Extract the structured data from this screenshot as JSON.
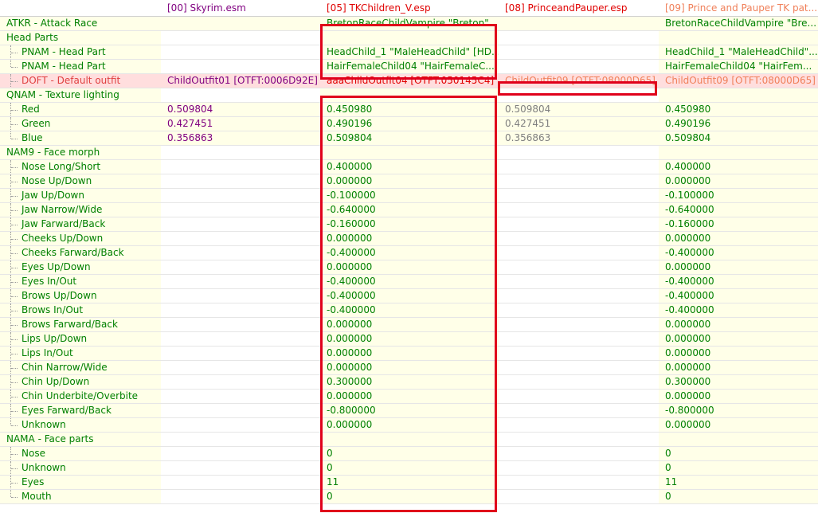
{
  "header": {
    "col0": "",
    "col1": "[00] Skyrim.esm",
    "col2": "[05] TKChildren_V.esp",
    "col3": "[08] PrinceandPauper.esp",
    "col4": "[09] Prince and Pauper TK pat..."
  },
  "colors": {
    "label": "#008000",
    "skyrim": "#800080",
    "override_conflict": "#e00000",
    "losing": "#7f7f7f",
    "highlight_border": "#e0001b"
  },
  "rows": [
    {
      "label": "ATKR - Attack Race",
      "c1": "",
      "c2": "BretonRaceChildVampire \"Breton\"...",
      "c3": "",
      "c4": "BretonRaceChildVampire \"Bre..."
    },
    {
      "label": "Head Parts",
      "c1": "",
      "c2": "",
      "c3": "",
      "c4": ""
    },
    {
      "label": "PNAM - Head Part",
      "c1": "",
      "c2": "HeadChild_1 \"MaleHeadChild\" [HD...",
      "c3": "",
      "c4": "HeadChild_1 \"MaleHeadChild\"..."
    },
    {
      "label": "PNAM - Head Part",
      "c1": "",
      "c2": "HairFemaleChild04 \"HairFemaleC...",
      "c3": "",
      "c4": "HairFemaleChild04 \"HairFem..."
    },
    {
      "label": "DOFT - Default outfit",
      "c1": "ChildOutfit01 [OTFT:0006D92E]",
      "c2": "aaaChildOutfit04 [OTFT:050145C4]",
      "c3": "ChildOutfit09 [OTFT:08000D65]",
      "c4": "ChildOutfit09 [OTFT:08000D65]"
    },
    {
      "label": "QNAM - Texture lighting",
      "c1": "",
      "c2": "",
      "c3": "",
      "c4": ""
    },
    {
      "label": "Red",
      "c1": "0.509804",
      "c2": "0.450980",
      "c3": "0.509804",
      "c4": "0.450980"
    },
    {
      "label": "Green",
      "c1": "0.427451",
      "c2": "0.490196",
      "c3": "0.427451",
      "c4": "0.490196"
    },
    {
      "label": "Blue",
      "c1": "0.356863",
      "c2": "0.509804",
      "c3": "0.356863",
      "c4": "0.509804"
    },
    {
      "label": "NAM9 - Face morph",
      "c1": "",
      "c2": "",
      "c3": "",
      "c4": ""
    },
    {
      "label": "Nose Long/Short",
      "c1": "",
      "c2": "0.400000",
      "c3": "",
      "c4": "0.400000"
    },
    {
      "label": "Nose Up/Down",
      "c1": "",
      "c2": "0.000000",
      "c3": "",
      "c4": "0.000000"
    },
    {
      "label": "Jaw Up/Down",
      "c1": "",
      "c2": "-0.100000",
      "c3": "",
      "c4": "-0.100000"
    },
    {
      "label": "Jaw Narrow/Wide",
      "c1": "",
      "c2": "-0.640000",
      "c3": "",
      "c4": "-0.640000"
    },
    {
      "label": "Jaw Farward/Back",
      "c1": "",
      "c2": "-0.160000",
      "c3": "",
      "c4": "-0.160000"
    },
    {
      "label": "Cheeks Up/Down",
      "c1": "",
      "c2": "0.000000",
      "c3": "",
      "c4": "0.000000"
    },
    {
      "label": "Cheeks Farward/Back",
      "c1": "",
      "c2": "-0.400000",
      "c3": "",
      "c4": "-0.400000"
    },
    {
      "label": "Eyes Up/Down",
      "c1": "",
      "c2": "0.000000",
      "c3": "",
      "c4": "0.000000"
    },
    {
      "label": "Eyes In/Out",
      "c1": "",
      "c2": "-0.400000",
      "c3": "",
      "c4": "-0.400000"
    },
    {
      "label": "Brows Up/Down",
      "c1": "",
      "c2": "-0.400000",
      "c3": "",
      "c4": "-0.400000"
    },
    {
      "label": "Brows In/Out",
      "c1": "",
      "c2": "-0.400000",
      "c3": "",
      "c4": "-0.400000"
    },
    {
      "label": "Brows Farward/Back",
      "c1": "",
      "c2": "0.000000",
      "c3": "",
      "c4": "0.000000"
    },
    {
      "label": "Lips Up/Down",
      "c1": "",
      "c2": "0.000000",
      "c3": "",
      "c4": "0.000000"
    },
    {
      "label": "Lips In/Out",
      "c1": "",
      "c2": "0.000000",
      "c3": "",
      "c4": "0.000000"
    },
    {
      "label": "Chin Narrow/Wide",
      "c1": "",
      "c2": "0.000000",
      "c3": "",
      "c4": "0.000000"
    },
    {
      "label": "Chin Up/Down",
      "c1": "",
      "c2": "0.300000",
      "c3": "",
      "c4": "0.300000"
    },
    {
      "label": "Chin Underbite/Overbite",
      "c1": "",
      "c2": "0.000000",
      "c3": "",
      "c4": "0.000000"
    },
    {
      "label": "Eyes Farward/Back",
      "c1": "",
      "c2": "-0.800000",
      "c3": "",
      "c4": "-0.800000"
    },
    {
      "label": "Unknown",
      "c1": "",
      "c2": "0.000000",
      "c3": "",
      "c4": "0.000000"
    },
    {
      "label": "NAMA - Face parts",
      "c1": "",
      "c2": "",
      "c3": "",
      "c4": ""
    },
    {
      "label": "Nose",
      "c1": "",
      "c2": "0",
      "c3": "",
      "c4": "0"
    },
    {
      "label": "Unknown",
      "c1": "",
      "c2": "0",
      "c3": "",
      "c4": "0"
    },
    {
      "label": "Eyes",
      "c1": "",
      "c2": "11",
      "c3": "",
      "c4": "11"
    },
    {
      "label": "Mouth",
      "c1": "",
      "c2": "0",
      "c3": "",
      "c4": "0"
    }
  ]
}
